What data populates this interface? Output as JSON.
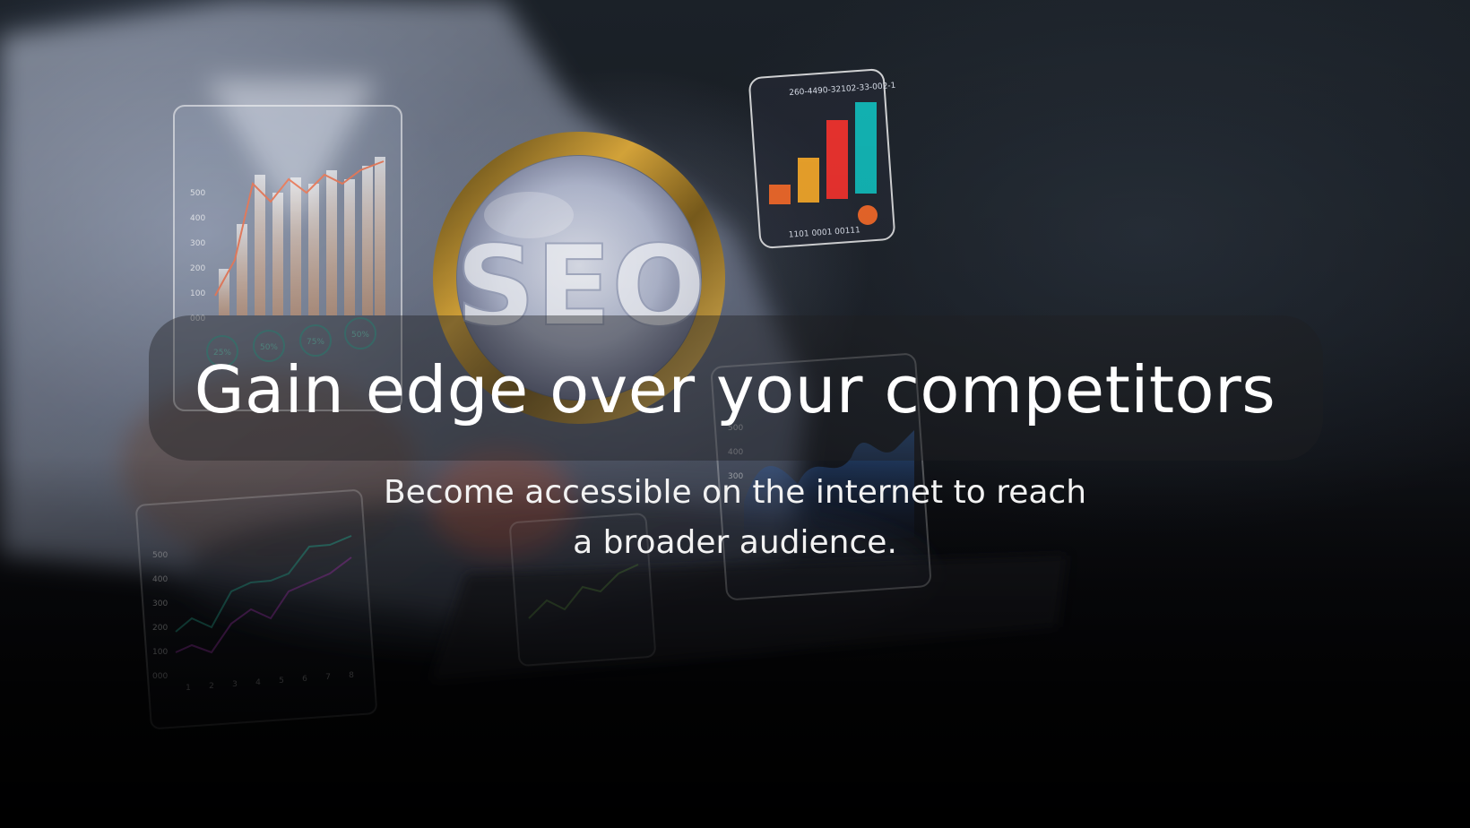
{
  "hero": {
    "headline": "Gain edge over your competitors",
    "subheadline": "Become accessible on the internet to reach a broader audience.",
    "photo": {
      "magnifier_text": "SEO",
      "panel_top_right": {
        "code_top": "260-4490-32102-33-002-1",
        "code_bottom": "1101 0001 00111",
        "bar_colors": [
          "#e8662a",
          "#e9a12a",
          "#e8322e",
          "#12b3b3"
        ]
      },
      "panel_left": {
        "y_ticks": [
          "500",
          "400",
          "300",
          "200",
          "100",
          "000"
        ],
        "gauges": [
          "25%",
          "50%",
          "75%",
          "50%"
        ]
      },
      "panel_bottom_left": {
        "y_ticks": [
          "500",
          "400",
          "300",
          "200",
          "100",
          "000"
        ],
        "x_ticks": [
          "1",
          "2",
          "3",
          "4",
          "5",
          "6",
          "7",
          "8"
        ]
      },
      "panel_right": {
        "y_ticks": [
          "500",
          "400",
          "300"
        ]
      }
    }
  }
}
